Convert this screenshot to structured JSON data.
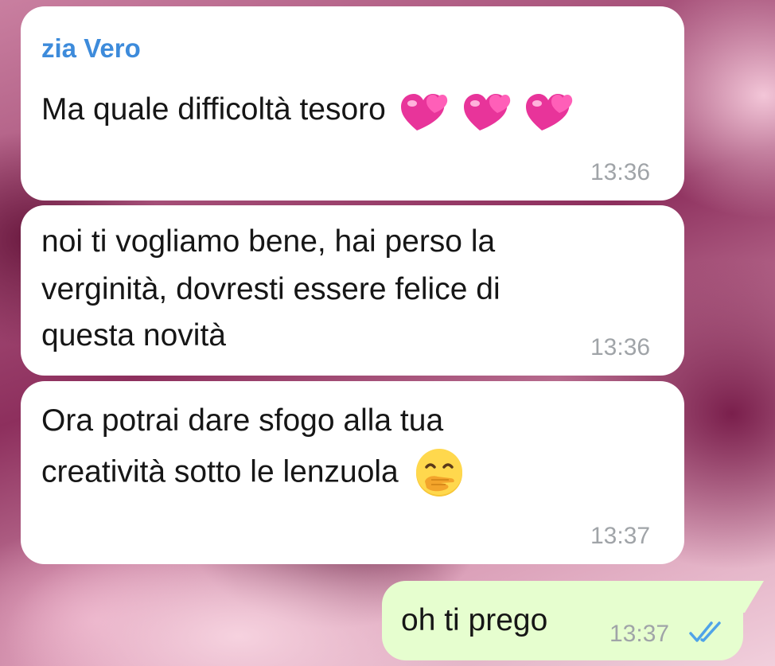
{
  "messages": [
    {
      "sender": "zia Vero",
      "text": "Ma quale difficoltà tesoro",
      "emoji": [
        "two-hearts-icon",
        "two-hearts-icon",
        "two-hearts-icon"
      ],
      "time": "13:36"
    },
    {
      "lines": [
        "noi ti vogliamo bene, hai perso la",
        "verginità, dovresti essere felice di",
        "questa novità"
      ],
      "time": "13:36"
    },
    {
      "lines": [
        "Ora potrai dare sfogo alla tua",
        "creatività sotto le lenzuola"
      ],
      "emoji": [
        "face-with-hand-over-mouth-icon"
      ],
      "time": "13:37"
    }
  ],
  "outgoing": {
    "text": "oh ti prego",
    "time": "13:37",
    "status_icon": "double-check-read-icon"
  },
  "colors": {
    "incoming_bubble": "#ffffff",
    "outgoing_bubble": "#e6fecf",
    "sender_name": "#3d8bdb",
    "timestamp": "#a0a4a8",
    "read_check": "#4fa3e8"
  }
}
